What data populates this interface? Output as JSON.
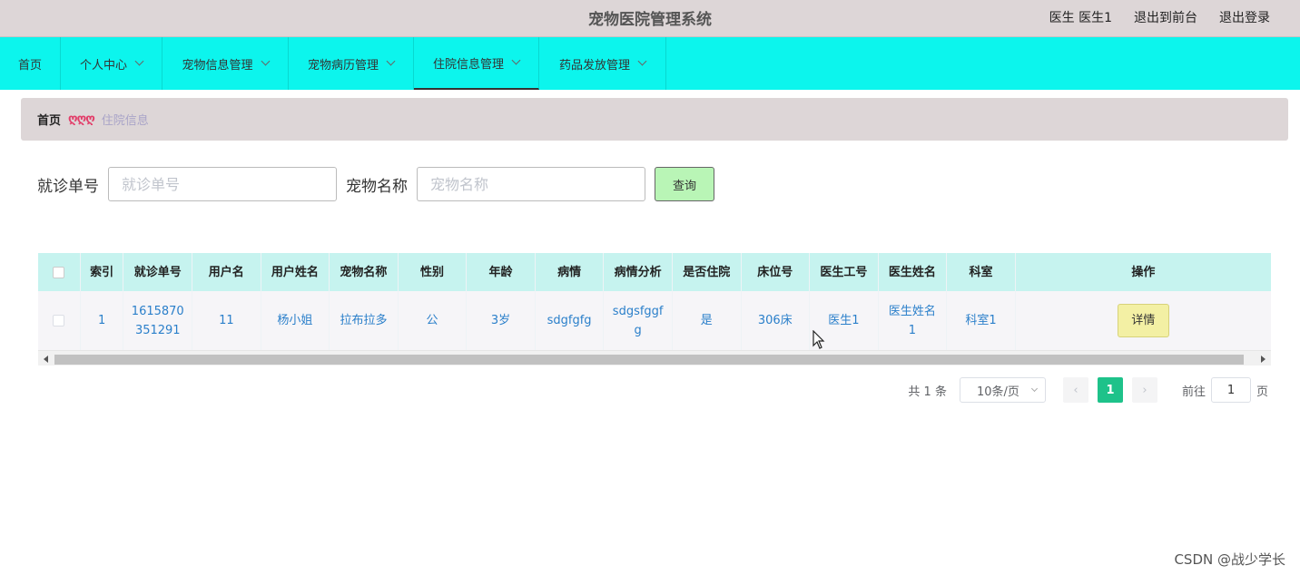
{
  "header": {
    "title": "宠物医院管理系统",
    "user_label": "医生 医生1",
    "to_front": "退出到前台",
    "logout": "退出登录"
  },
  "nav": {
    "items": [
      {
        "label": "首页"
      },
      {
        "label": "个人中心"
      },
      {
        "label": "宠物信息管理"
      },
      {
        "label": "宠物病历管理"
      },
      {
        "label": "住院信息管理"
      },
      {
        "label": "药品发放管理"
      }
    ]
  },
  "breadcrumb": {
    "home": "首页",
    "separator": "ღღღ",
    "current": "住院信息"
  },
  "search": {
    "field1_label": "就诊单号",
    "field1_placeholder": "就诊单号",
    "field2_label": "宠物名称",
    "field2_placeholder": "宠物名称",
    "query_label": "查询"
  },
  "table": {
    "headers": [
      "索引",
      "就诊单号",
      "用户名",
      "用户姓名",
      "宠物名称",
      "性别",
      "年龄",
      "病情",
      "病情分析",
      "是否住院",
      "床位号",
      "医生工号",
      "医生姓名",
      "科室",
      "操作"
    ],
    "rows": [
      {
        "index": "1",
        "visit_no": "1615870351291",
        "username": "11",
        "user_name": "杨小姐",
        "pet_name": "拉布拉多",
        "gender": "公",
        "age": "3岁",
        "condition": "sdgfgfg",
        "analysis": "sdgsfggfg",
        "hospitalized": "是",
        "bed_no": "306床",
        "doctor_id": "医生1",
        "doctor_name": "医生姓名1",
        "department": "科室1",
        "action": "详情"
      }
    ]
  },
  "pagination": {
    "total": "共 1 条",
    "page_size": "10条/页",
    "current_page": "1",
    "goto_prefix": "前往",
    "goto_value": "1",
    "goto_suffix": "页"
  },
  "watermark": "CSDN @战少学长",
  "colors": {
    "header_bg": "#ddd6d7",
    "nav_bg": "#0cf5ed",
    "table_head_bg": "#c6f3ef",
    "query_btn_bg": "#b9f5b6",
    "detail_btn_bg": "#f3f0a4",
    "page_active": "#1ec28a",
    "link_text": "#2a7fca"
  }
}
